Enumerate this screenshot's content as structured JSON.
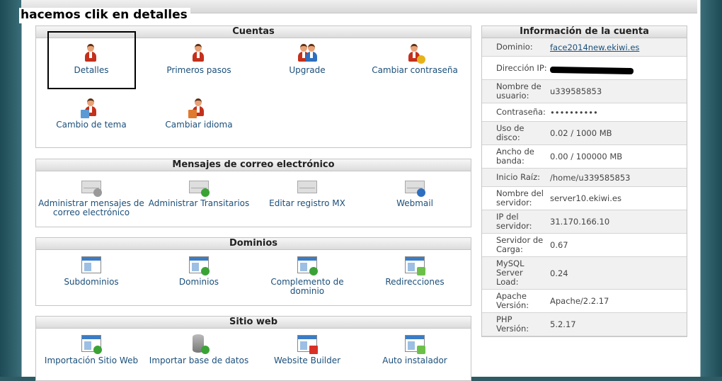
{
  "annotation": "hacemos clik en detalles",
  "panels": {
    "cuentas": {
      "title": "Cuentas",
      "items": [
        "Detalles",
        "Primeros pasos",
        "Upgrade",
        "Cambiar contraseña",
        "Cambio de tema",
        "Cambiar idioma"
      ]
    },
    "correo": {
      "title": "Mensajes de correo electrónico",
      "items": [
        "Administrar mensajes de correo electrónico",
        "Administrar Transitarios",
        "Editar registro MX",
        "Webmail"
      ]
    },
    "dominios": {
      "title": "Dominios",
      "items": [
        "Subdominios",
        "Dominios",
        "Complemento de dominio",
        "Redirecciones"
      ]
    },
    "sitio": {
      "title": "Sitio web",
      "items": [
        "Importación Sitio Web",
        "Importar base de datos",
        "Website Builder",
        "Auto instalador"
      ]
    }
  },
  "account_info": {
    "title": "Información de la cuenta",
    "rows": [
      {
        "k": "Dominio:",
        "v": "face2014new.ekiwi.es"
      },
      {
        "k": "Dirección IP:",
        "v": ""
      },
      {
        "k": "Nombre de usuario:",
        "v": "u339585853"
      },
      {
        "k": "Contraseña:",
        "v": "••••••••••"
      },
      {
        "k": "Uso de disco:",
        "v": "0.02 / 1000 MB"
      },
      {
        "k": "Ancho de banda:",
        "v": "0.00 / 100000 MB"
      },
      {
        "k": "Inicio Raíz:",
        "v": "/home/u339585853"
      },
      {
        "k": "Nombre del servidor:",
        "v": "server10.ekiwi.es"
      },
      {
        "k": "IP del servidor:",
        "v": "31.170.166.10"
      },
      {
        "k": "Servidor de Carga:",
        "v": "0.67"
      },
      {
        "k": "MySQL Server Load:",
        "v": "0.24"
      },
      {
        "k": "Apache Versión:",
        "v": "Apache/2.2.17"
      },
      {
        "k": "PHP Versión:",
        "v": "5.2.17"
      }
    ]
  },
  "colors": {
    "link": "#1b4f7a",
    "badge_green": "#3aa335",
    "badge_orange": "#e89b1c",
    "globe_blue": "#2d6fc0"
  }
}
